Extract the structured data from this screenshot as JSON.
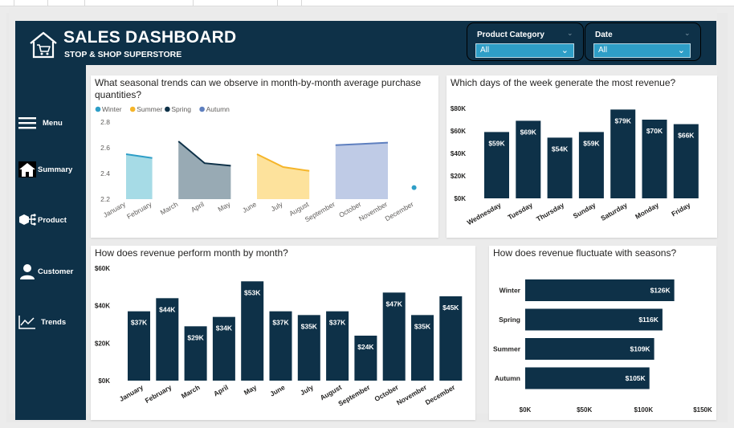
{
  "header": {
    "title": "SALES DASHBOARD",
    "subtitle": "STOP &  SHOP SUPERSTORE"
  },
  "slicers": [
    {
      "label": "Product Category",
      "value": "All"
    },
    {
      "label": "Date",
      "value": "All"
    }
  ],
  "nav": [
    {
      "label": "Menu",
      "icon": "hamburger-icon"
    },
    {
      "label": "Summary",
      "icon": "home-icon"
    },
    {
      "label": "Product",
      "icon": "product-icon"
    },
    {
      "label": "Customer",
      "icon": "person-icon"
    },
    {
      "label": "Trends",
      "icon": "trend-icon"
    }
  ],
  "colors": {
    "dark_navy": "#0e3148",
    "bar": "#0e3148",
    "slicer_blue": "#2e9ec7",
    "winter": "#2e9ec7",
    "summer": "#f5b52a",
    "spring": "#0e3148",
    "autumn": "#5e7fbf"
  },
  "chart_data": [
    {
      "type": "area",
      "title": "What seasonal trends can we observe in month-by-month average purchase quantities?",
      "legend": [
        "Winter",
        "Summer",
        "Spring",
        "Autumn"
      ],
      "legend_position": "top-left",
      "categories": [
        "January",
        "February",
        "March",
        "April",
        "May",
        "June",
        "July",
        "August",
        "September",
        "October",
        "November",
        "December"
      ],
      "series": [
        {
          "name": "Winter",
          "values": [
            2.55,
            2.52,
            null,
            null,
            null,
            null,
            null,
            null,
            null,
            null,
            null,
            2.29
          ]
        },
        {
          "name": "Summer",
          "values": [
            null,
            null,
            null,
            null,
            null,
            2.55,
            2.45,
            2.42,
            null,
            null,
            null,
            null
          ]
        },
        {
          "name": "Spring",
          "values": [
            null,
            null,
            2.65,
            2.48,
            2.46,
            null,
            null,
            null,
            null,
            null,
            null,
            null
          ]
        },
        {
          "name": "Autumn",
          "values": [
            null,
            null,
            null,
            null,
            null,
            null,
            null,
            null,
            2.62,
            2.63,
            2.64,
            null
          ]
        }
      ],
      "yticks": [
        "2.8",
        "2.6",
        "2.4",
        "2.2"
      ],
      "ylim": [
        2.2,
        2.8
      ]
    },
    {
      "type": "bar",
      "title": "Which days of the week generate the most revenue?",
      "categories": [
        "Wednesday",
        "Tuesday",
        "Thursday",
        "Sunday",
        "Saturday",
        "Monday",
        "Friday"
      ],
      "values": [
        59,
        69,
        54,
        59,
        79,
        70,
        66
      ],
      "data_labels": [
        "$59K",
        "$69K",
        "$54K",
        "$59K",
        "$79K",
        "$70K",
        "$66K"
      ],
      "yticks": [
        "$80K",
        "$60K",
        "$40K",
        "$20K",
        "$0K"
      ],
      "ylim": [
        0,
        80
      ]
    },
    {
      "type": "bar",
      "title": "How does revenue perform month by month?",
      "categories": [
        "January",
        "February",
        "March",
        "April",
        "May",
        "June",
        "July",
        "August",
        "September",
        "October",
        "November",
        "December"
      ],
      "values": [
        37,
        44,
        29,
        34,
        53,
        37,
        35,
        37,
        24,
        47,
        35,
        45
      ],
      "data_labels": [
        "$37K",
        "$44K",
        "$29K",
        "$34K",
        "$53K",
        "$37K",
        "$35K",
        "$37K",
        "$24K",
        "$47K",
        "$35K",
        "$45K"
      ],
      "yticks": [
        "$60K",
        "$40K",
        "$20K",
        "$0K"
      ],
      "ylim": [
        0,
        60
      ]
    },
    {
      "type": "bar",
      "orientation": "horizontal",
      "title": "How does revenue fluctuate with seasons?",
      "categories": [
        "Winter",
        "Spring",
        "Summer",
        "Autumn"
      ],
      "values": [
        126,
        116,
        109,
        105
      ],
      "data_labels": [
        "$126K",
        "$116K",
        "$109K",
        "$105K"
      ],
      "xticks": [
        "$0K",
        "$50K",
        "$100K",
        "$150K"
      ],
      "xlim": [
        0,
        150
      ]
    }
  ]
}
